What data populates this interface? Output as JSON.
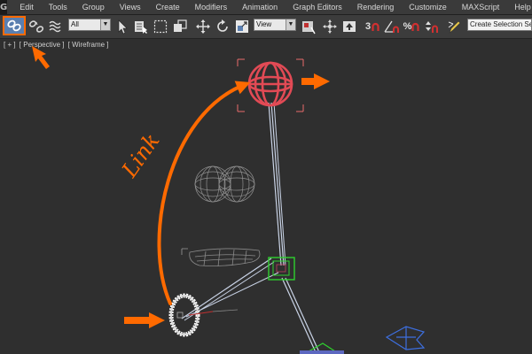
{
  "menubar": {
    "items": [
      "Edit",
      "Tools",
      "Group",
      "Views",
      "Create",
      "Modifiers",
      "Animation",
      "Graph Editors",
      "Rendering",
      "Customize",
      "MAXScript",
      "Help"
    ]
  },
  "toolbar": {
    "selection_filter": "All",
    "reference_coordinate": "View",
    "snap_label": "3",
    "percent_snap_label": "%",
    "named_selection_set": "Create Selection Se"
  },
  "viewport": {
    "labels": [
      "[ + ]",
      "[ Perspective ]",
      "[ Wireframe ]"
    ],
    "annotation_text": "Link",
    "colors": {
      "annotation_orange": "#ff6a00",
      "selected_red": "#e24a55",
      "selection_bracket": "#e96b6b",
      "helper_green": "#2fd12f"
    }
  }
}
